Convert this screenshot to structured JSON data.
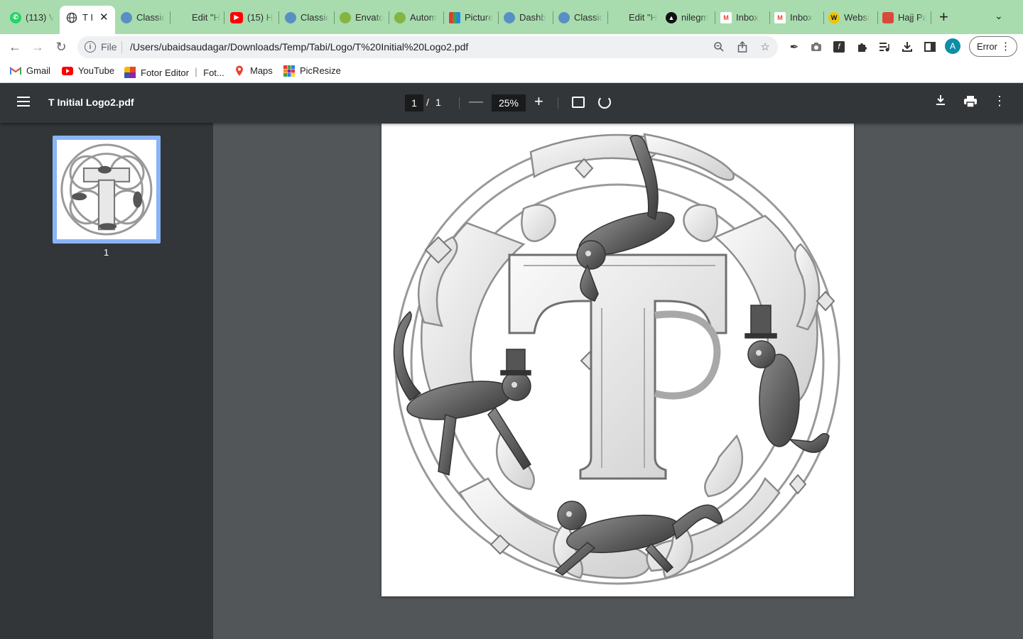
{
  "tabs": [
    {
      "label": "(113) V",
      "icon": "whatsapp-icon",
      "color": "#25d366"
    },
    {
      "label": "T I",
      "icon": "globe-icon",
      "active": true
    },
    {
      "label": "Classic",
      "icon": "globe-icon"
    },
    {
      "label": "Edit \"H",
      "icon": "blank-icon"
    },
    {
      "label": "(15) H",
      "icon": "youtube-icon",
      "color": "#ff0000"
    },
    {
      "label": "Classic",
      "icon": "globe-icon"
    },
    {
      "label": "Envato",
      "icon": "leaf-icon",
      "color": "#82b541"
    },
    {
      "label": "Autom",
      "icon": "leaf-icon",
      "color": "#82b541"
    },
    {
      "label": "Picture",
      "icon": "picresize-icon"
    },
    {
      "label": "Dashb",
      "icon": "globe-icon"
    },
    {
      "label": "Classic",
      "icon": "globe-icon"
    },
    {
      "label": "Edit \"H",
      "icon": "blank-icon"
    },
    {
      "label": "nilegm",
      "icon": "circle-a-icon"
    },
    {
      "label": "Inbox",
      "icon": "gmail-icon"
    },
    {
      "label": "Inbox",
      "icon": "gmail-icon"
    },
    {
      "label": "Websi",
      "icon": "w-icon",
      "color": "#f2c200"
    },
    {
      "label": "Hajj Pa",
      "icon": "hajj-icon"
    }
  ],
  "toolbar": {
    "file_label": "File",
    "url": "/Users/ubaidsaudagar/Downloads/Temp/Tabi/Logo/T%20Initial%20Logo2.pdf",
    "avatar_letter": "A",
    "error_label": "Error"
  },
  "bookmarks": [
    {
      "label": "Gmail",
      "icon": "gmail-icon"
    },
    {
      "label": "YouTube",
      "icon": "youtube-icon"
    },
    {
      "label": "Fotor Editor ｜ Fot...",
      "icon": "fotor-icon"
    },
    {
      "label": "Maps",
      "icon": "maps-icon"
    },
    {
      "label": "PicResize",
      "icon": "picresize-icon"
    }
  ],
  "pdf": {
    "title": "T Initial Logo2.pdf",
    "current_page": "1",
    "page_separator": "/",
    "total_pages": "1",
    "zoom": "25%",
    "thumbnail_label": "1"
  }
}
